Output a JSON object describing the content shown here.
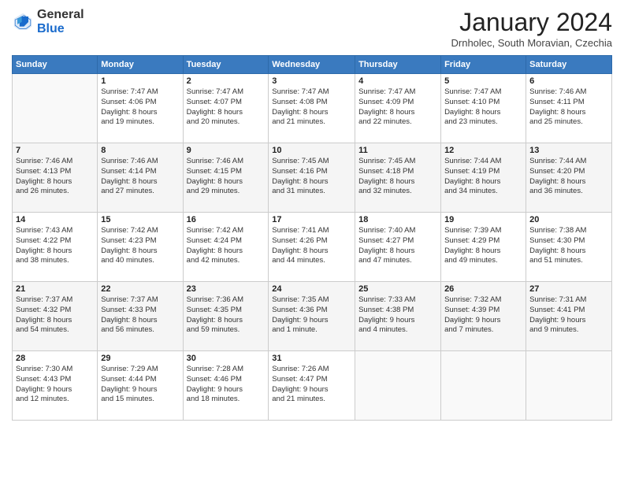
{
  "logo": {
    "general": "General",
    "blue": "Blue"
  },
  "title": "January 2024",
  "subtitle": "Drnholec, South Moravian, Czechia",
  "weekdays": [
    "Sunday",
    "Monday",
    "Tuesday",
    "Wednesday",
    "Thursday",
    "Friday",
    "Saturday"
  ],
  "weeks": [
    [
      {
        "day": "",
        "info": ""
      },
      {
        "day": "1",
        "info": "Sunrise: 7:47 AM\nSunset: 4:06 PM\nDaylight: 8 hours\nand 19 minutes."
      },
      {
        "day": "2",
        "info": "Sunrise: 7:47 AM\nSunset: 4:07 PM\nDaylight: 8 hours\nand 20 minutes."
      },
      {
        "day": "3",
        "info": "Sunrise: 7:47 AM\nSunset: 4:08 PM\nDaylight: 8 hours\nand 21 minutes."
      },
      {
        "day": "4",
        "info": "Sunrise: 7:47 AM\nSunset: 4:09 PM\nDaylight: 8 hours\nand 22 minutes."
      },
      {
        "day": "5",
        "info": "Sunrise: 7:47 AM\nSunset: 4:10 PM\nDaylight: 8 hours\nand 23 minutes."
      },
      {
        "day": "6",
        "info": "Sunrise: 7:46 AM\nSunset: 4:11 PM\nDaylight: 8 hours\nand 25 minutes."
      }
    ],
    [
      {
        "day": "7",
        "info": "Sunrise: 7:46 AM\nSunset: 4:13 PM\nDaylight: 8 hours\nand 26 minutes."
      },
      {
        "day": "8",
        "info": "Sunrise: 7:46 AM\nSunset: 4:14 PM\nDaylight: 8 hours\nand 27 minutes."
      },
      {
        "day": "9",
        "info": "Sunrise: 7:46 AM\nSunset: 4:15 PM\nDaylight: 8 hours\nand 29 minutes."
      },
      {
        "day": "10",
        "info": "Sunrise: 7:45 AM\nSunset: 4:16 PM\nDaylight: 8 hours\nand 31 minutes."
      },
      {
        "day": "11",
        "info": "Sunrise: 7:45 AM\nSunset: 4:18 PM\nDaylight: 8 hours\nand 32 minutes."
      },
      {
        "day": "12",
        "info": "Sunrise: 7:44 AM\nSunset: 4:19 PM\nDaylight: 8 hours\nand 34 minutes."
      },
      {
        "day": "13",
        "info": "Sunrise: 7:44 AM\nSunset: 4:20 PM\nDaylight: 8 hours\nand 36 minutes."
      }
    ],
    [
      {
        "day": "14",
        "info": "Sunrise: 7:43 AM\nSunset: 4:22 PM\nDaylight: 8 hours\nand 38 minutes."
      },
      {
        "day": "15",
        "info": "Sunrise: 7:42 AM\nSunset: 4:23 PM\nDaylight: 8 hours\nand 40 minutes."
      },
      {
        "day": "16",
        "info": "Sunrise: 7:42 AM\nSunset: 4:24 PM\nDaylight: 8 hours\nand 42 minutes."
      },
      {
        "day": "17",
        "info": "Sunrise: 7:41 AM\nSunset: 4:26 PM\nDaylight: 8 hours\nand 44 minutes."
      },
      {
        "day": "18",
        "info": "Sunrise: 7:40 AM\nSunset: 4:27 PM\nDaylight: 8 hours\nand 47 minutes."
      },
      {
        "day": "19",
        "info": "Sunrise: 7:39 AM\nSunset: 4:29 PM\nDaylight: 8 hours\nand 49 minutes."
      },
      {
        "day": "20",
        "info": "Sunrise: 7:38 AM\nSunset: 4:30 PM\nDaylight: 8 hours\nand 51 minutes."
      }
    ],
    [
      {
        "day": "21",
        "info": "Sunrise: 7:37 AM\nSunset: 4:32 PM\nDaylight: 8 hours\nand 54 minutes."
      },
      {
        "day": "22",
        "info": "Sunrise: 7:37 AM\nSunset: 4:33 PM\nDaylight: 8 hours\nand 56 minutes."
      },
      {
        "day": "23",
        "info": "Sunrise: 7:36 AM\nSunset: 4:35 PM\nDaylight: 8 hours\nand 59 minutes."
      },
      {
        "day": "24",
        "info": "Sunrise: 7:35 AM\nSunset: 4:36 PM\nDaylight: 9 hours\nand 1 minute."
      },
      {
        "day": "25",
        "info": "Sunrise: 7:33 AM\nSunset: 4:38 PM\nDaylight: 9 hours\nand 4 minutes."
      },
      {
        "day": "26",
        "info": "Sunrise: 7:32 AM\nSunset: 4:39 PM\nDaylight: 9 hours\nand 7 minutes."
      },
      {
        "day": "27",
        "info": "Sunrise: 7:31 AM\nSunset: 4:41 PM\nDaylight: 9 hours\nand 9 minutes."
      }
    ],
    [
      {
        "day": "28",
        "info": "Sunrise: 7:30 AM\nSunset: 4:43 PM\nDaylight: 9 hours\nand 12 minutes."
      },
      {
        "day": "29",
        "info": "Sunrise: 7:29 AM\nSunset: 4:44 PM\nDaylight: 9 hours\nand 15 minutes."
      },
      {
        "day": "30",
        "info": "Sunrise: 7:28 AM\nSunset: 4:46 PM\nDaylight: 9 hours\nand 18 minutes."
      },
      {
        "day": "31",
        "info": "Sunrise: 7:26 AM\nSunset: 4:47 PM\nDaylight: 9 hours\nand 21 minutes."
      },
      {
        "day": "",
        "info": ""
      },
      {
        "day": "",
        "info": ""
      },
      {
        "day": "",
        "info": ""
      }
    ]
  ]
}
